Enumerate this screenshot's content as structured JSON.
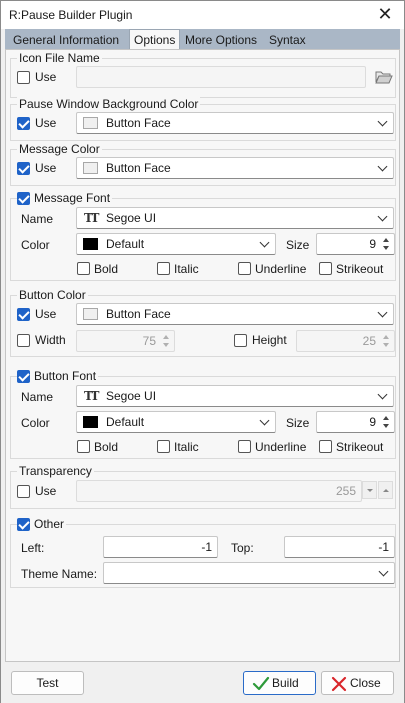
{
  "window": {
    "title": "R:Pause Builder Plugin",
    "close_glyph": "✕"
  },
  "tabs": [
    "General Information",
    "Options",
    "More Options",
    "Syntax"
  ],
  "active_tab": "Options",
  "icon_file": {
    "legend": "Icon File Name",
    "use_label": "Use",
    "use_checked": false,
    "value": "",
    "browse_icon": "folder-open-icon"
  },
  "pause_bg": {
    "legend": "Pause Window Background Color",
    "use_label": "Use",
    "use_checked": true,
    "color_value": "Button Face",
    "swatch": "#f0f0f0"
  },
  "message_color": {
    "legend": "Message Color",
    "use_label": "Use",
    "use_checked": true,
    "color_value": "Button Face",
    "swatch": "#f0f0f0"
  },
  "message_font": {
    "legend": "Message Font",
    "checked": true,
    "name_label": "Name",
    "name_value": "Segoe UI",
    "color_label": "Color",
    "color_value": "Default",
    "swatch": "#000000",
    "size_label": "Size",
    "size_value": "9",
    "styles": [
      "Bold",
      "Italic",
      "Underline",
      "Strikeout"
    ]
  },
  "button_color": {
    "legend": "Button Color",
    "use_label": "Use",
    "use_checked": true,
    "color_value": "Button Face",
    "swatch": "#f0f0f0",
    "width_label": "Width",
    "width_value": "75",
    "height_label": "Height",
    "height_value": "25"
  },
  "button_font": {
    "legend": "Button Font",
    "checked": true,
    "name_label": "Name",
    "name_value": "Segoe UI",
    "color_label": "Color",
    "color_value": "Default",
    "swatch": "#000000",
    "size_label": "Size",
    "size_value": "9",
    "styles": [
      "Bold",
      "Italic",
      "Underline",
      "Strikeout"
    ]
  },
  "transparency": {
    "legend": "Transparency",
    "use_label": "Use",
    "use_checked": false,
    "value": "255"
  },
  "other": {
    "legend": "Other",
    "checked": true,
    "left_label": "Left:",
    "left_value": "-1",
    "top_label": "Top:",
    "top_value": "-1",
    "theme_label": "Theme Name:",
    "theme_value": ""
  },
  "footer": {
    "test_label": "Test",
    "build_label": "Build",
    "close_label": "Close"
  },
  "colors": {
    "accent": "#1f63c8",
    "tabstrip": "#aab7c6",
    "build_check": "#2e9a3a",
    "close_x": "#d9262b"
  }
}
